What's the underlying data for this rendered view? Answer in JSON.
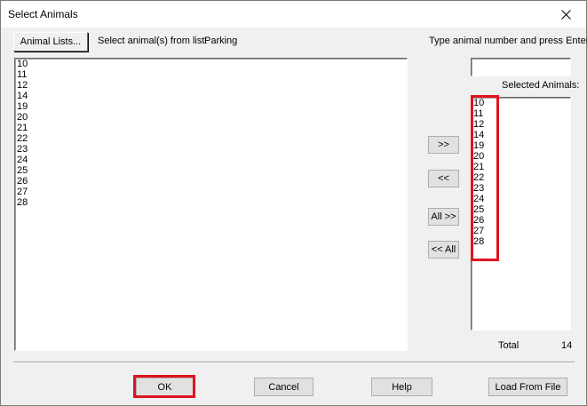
{
  "window": {
    "title": "Select Animals"
  },
  "toolbar": {
    "animal_lists_label": "Animal Lists...",
    "select_from_list_label": "Select animal(s) from list:",
    "list_name": "Parking",
    "type_prompt": "Type animal number and press Enter"
  },
  "available_list": {
    "items": [
      "10",
      "11",
      "12",
      "14",
      "19",
      "20",
      "21",
      "22",
      "23",
      "24",
      "25",
      "26",
      "27",
      "28"
    ]
  },
  "entry": {
    "value": ""
  },
  "selected": {
    "label": "Selected Animals:",
    "items": [
      "10",
      "11",
      "12",
      "14",
      "19",
      "20",
      "21",
      "22",
      "23",
      "24",
      "25",
      "26",
      "27",
      "28"
    ],
    "total_label": "Total",
    "total_value": "14"
  },
  "transfer": {
    "add_label": ">>",
    "remove_label": "<<",
    "add_all_label": "All >>",
    "remove_all_label": "<< All"
  },
  "footer": {
    "ok_label": "OK",
    "cancel_label": "Cancel",
    "help_label": "Help",
    "load_label": "Load From File"
  },
  "colors": {
    "highlight": "#e0141e",
    "dialog_bg": "#f0f0f0"
  },
  "icons": {
    "close": "close-icon"
  }
}
